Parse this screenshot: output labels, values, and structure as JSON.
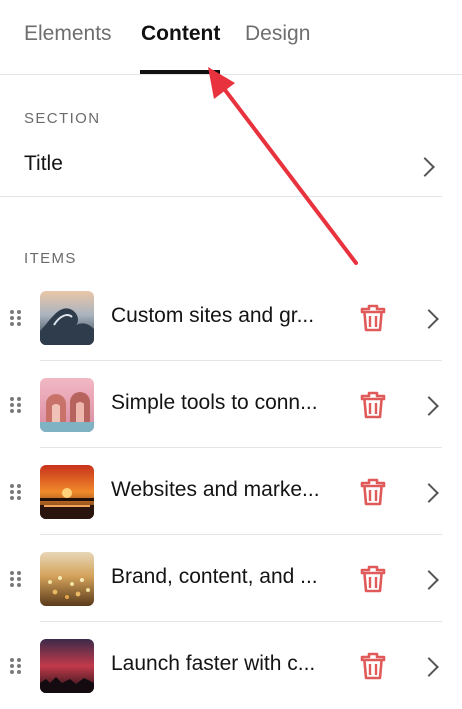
{
  "tabs": [
    {
      "label": "Elements",
      "active": false
    },
    {
      "label": "Content",
      "active": true
    },
    {
      "label": "Design",
      "active": false
    }
  ],
  "section": {
    "heading": "SECTION",
    "title_label": "Title"
  },
  "items_heading": "ITEMS",
  "items": [
    {
      "label": "Custom sites and gr...",
      "thumbnail": "ocean-wave-image"
    },
    {
      "label": "Simple tools to conn...",
      "thumbnail": "pink-arches-image"
    },
    {
      "label": "Websites and marke...",
      "thumbnail": "orange-sunset-image"
    },
    {
      "label": "Brand, content, and ...",
      "thumbnail": "wildflower-field-image"
    },
    {
      "label": "Launch faster with c...",
      "thumbnail": "red-dusk-sky-image"
    }
  ],
  "colors": {
    "accent_red": "#e8333f",
    "trash_red": "#e05a5a",
    "divider": "#e4e4e4"
  },
  "icons": [
    "drag-handle-icon",
    "trash-icon",
    "chevron-right-icon",
    "annotation-arrow"
  ]
}
